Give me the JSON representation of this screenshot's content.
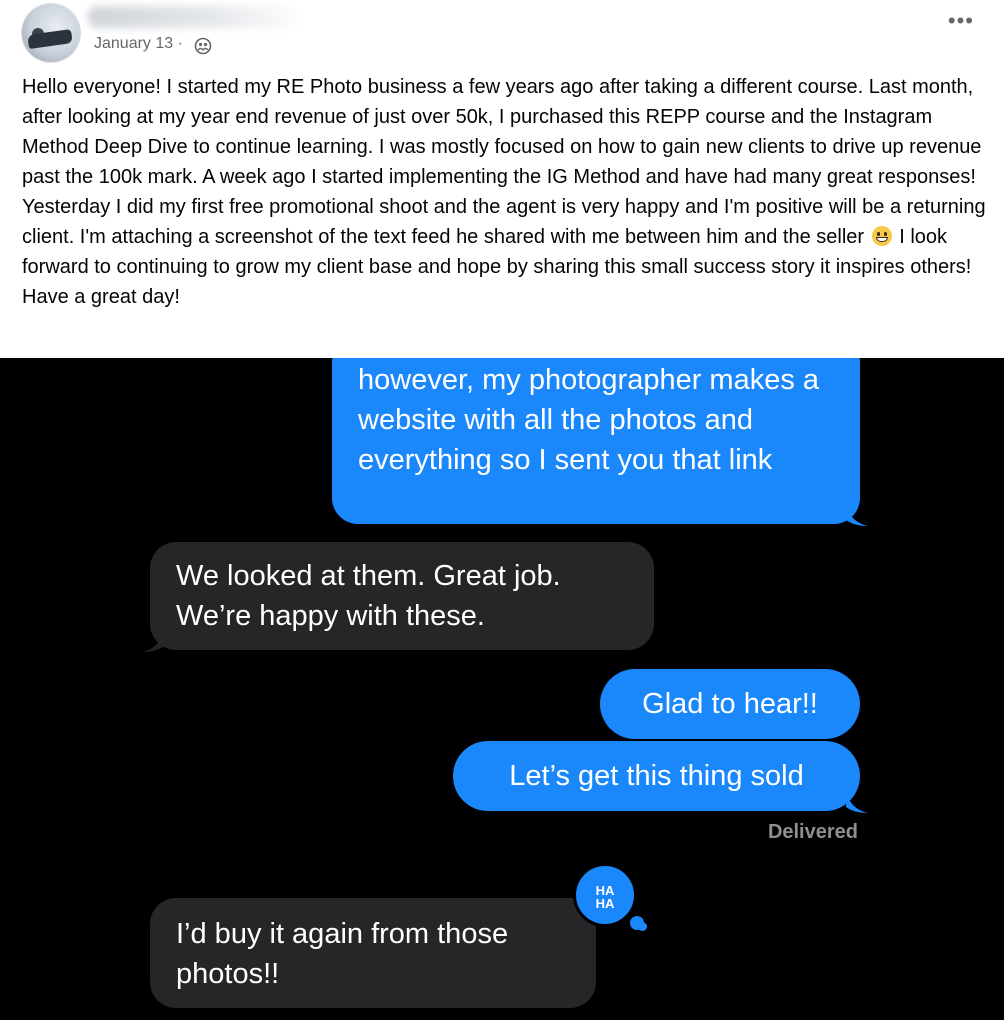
{
  "post": {
    "author_name": "",
    "date": "January 13",
    "date_separator": "·",
    "audience_icon": "friends-icon",
    "more_icon": "•••",
    "text_part1": "Hello everyone! I started my RE Photo business a few years ago after taking a different course. Last month, after looking at my year end revenue of just over 50k, I purchased this REPP course and the Instagram Method Deep Dive to continue learning. I was mostly focused on how to gain new clients to drive up revenue past the 100k mark. A week ago I started implementing the IG Method and have had many great responses! Yesterday I did my first free promotional shoot and the agent is very happy and I'm positive will be a returning client. I'm attaching a screenshot of the text feed he shared with me between him and the seller",
    "emoji_icon": "grinning-face-emoji",
    "text_part2": "I look forward to continuing to grow my client base and hope by sharing this small success story it inspires others! Have a great day!"
  },
  "chat": {
    "messages": [
      {
        "direction": "outgoing",
        "text": "however, my photographer makes a website with all the photos and everything so I sent you that link"
      },
      {
        "direction": "incoming",
        "text": "We looked at them. Great job. We’re happy with these."
      },
      {
        "direction": "outgoing",
        "text": "Glad to hear!!"
      },
      {
        "direction": "outgoing",
        "text": "Let’s get this thing sold"
      },
      {
        "direction": "incoming",
        "text": "I’d buy it again from those photos!!"
      }
    ],
    "status": "Delivered",
    "reaction": {
      "icon": "haha-reaction-icon",
      "line1": "HA",
      "line2": "HA"
    }
  },
  "colors": {
    "outgoing_bubble": "#1a87fb",
    "incoming_bubble": "#262628",
    "chat_background": "#000000",
    "status_text": "#8e8e93"
  }
}
